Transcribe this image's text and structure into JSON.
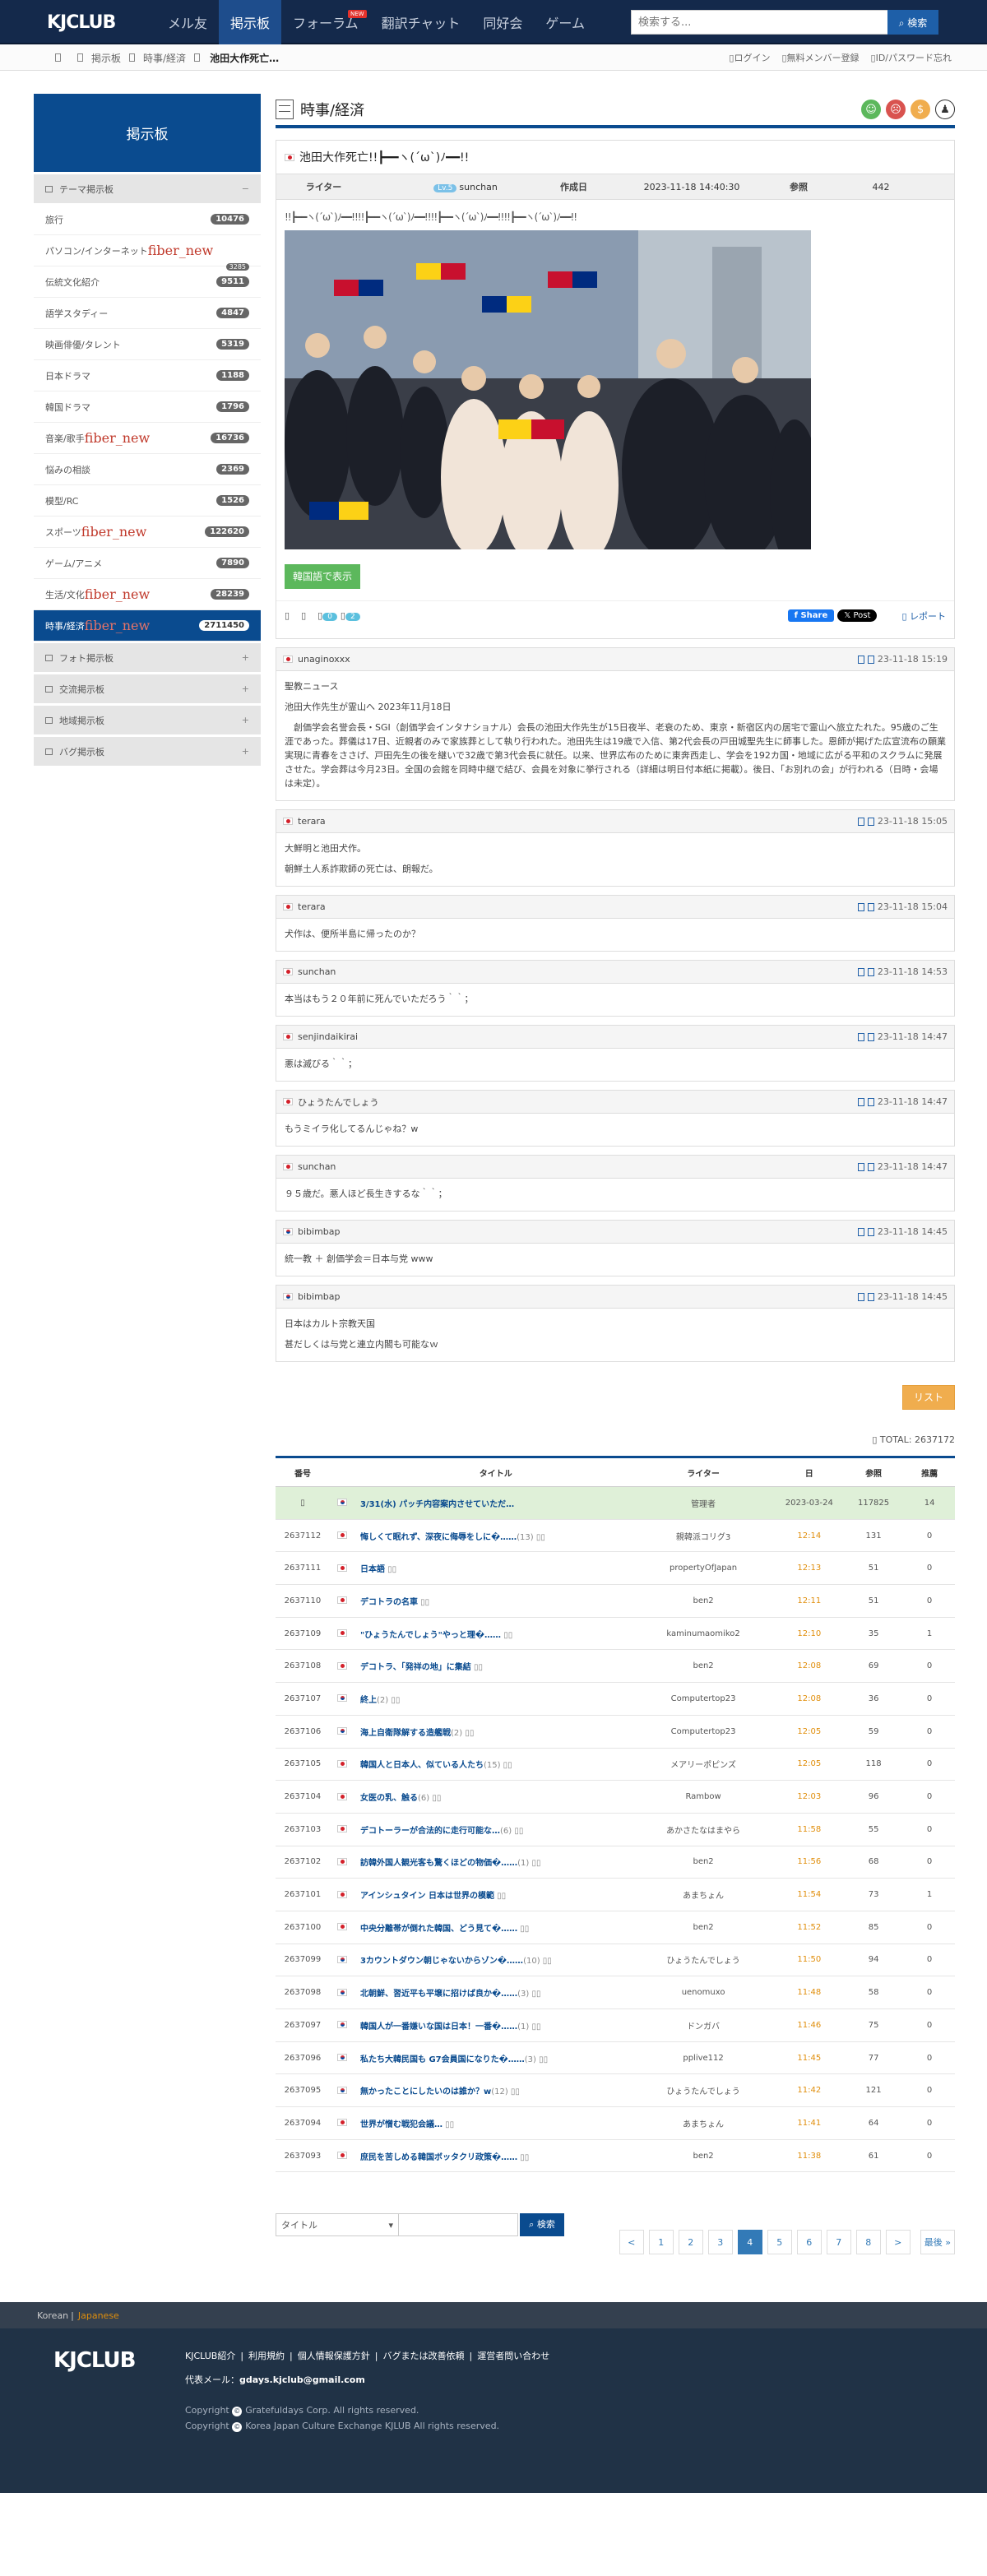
{
  "brand": {
    "logo": "KJCLUB"
  },
  "nav": {
    "items": [
      {
        "label": "メル友"
      },
      {
        "label": "掲示板",
        "active": true
      },
      {
        "label": "フォーラム",
        "badge": "NEW"
      },
      {
        "label": "翻訳チャット"
      },
      {
        "label": "同好会"
      },
      {
        "label": "ゲーム"
      }
    ],
    "search_placeholder": "検索する...",
    "search_button": "検索"
  },
  "breadcrumb": {
    "items": [
      "掲示板",
      "時事/経済",
      "池田大作死亡…"
    ]
  },
  "account": {
    "login": "ログイン",
    "register": "無料メンバー登録",
    "forgot": "ID/パスワード忘れ"
  },
  "sidebar": {
    "title": "掲示板",
    "section_theme": "テーマ掲示板",
    "section_theme_sym": "−",
    "items": [
      {
        "label": "旅行",
        "count": "10476"
      },
      {
        "label": "パソコン/インターネット",
        "suffix": "fiber_new",
        "count": "3285"
      },
      {
        "label": "伝統文化紹介",
        "count": "9511"
      },
      {
        "label": "語学スタディー",
        "count": "4847"
      },
      {
        "label": "映画俳優/タレント",
        "count": "5319"
      },
      {
        "label": "日本ドラマ",
        "count": "1188"
      },
      {
        "label": "韓国ドラマ",
        "count": "1796"
      },
      {
        "label": "音楽/歌手",
        "suffix": "fiber_new",
        "count": "16736"
      },
      {
        "label": "悩みの相談",
        "count": "2369"
      },
      {
        "label": "模型/RC",
        "count": "1526"
      },
      {
        "label": "スポーツ",
        "suffix": "fiber_new",
        "count": "122620"
      },
      {
        "label": "ゲーム/アニメ",
        "count": "7890"
      },
      {
        "label": "生活/文化",
        "suffix": "fiber_new",
        "count": "28239"
      },
      {
        "label": "時事/経済",
        "suffix": "fiber_new",
        "count": "2711450",
        "active": true
      }
    ],
    "sections": [
      {
        "label": "フォト掲示板",
        "sym": "+"
      },
      {
        "label": "交流掲示板",
        "sym": "+"
      },
      {
        "label": "地域掲示板",
        "sym": "+"
      },
      {
        "label": "バグ掲示板",
        "sym": "+"
      }
    ]
  },
  "page": {
    "title": "時事/経済"
  },
  "post": {
    "title": "池田大作死亡!!┣━━ヽ(´ω`)ﾉ━━!!",
    "meta": {
      "writer_label": "ライター",
      "writer_level": "Lv.5",
      "writer": "sunchan",
      "date_label": "作成日",
      "date": "2023-11-18 14:40:30",
      "views_label": "参照",
      "views": "442"
    },
    "body_line": "!!┣━━ヽ(´ω`)ﾉ━━!!!!┣━━ヽ(´ω`)ﾉ━━!!!!┣━━ヽ(´ω`)ﾉ━━!!!!┣━━ヽ(´ω`)ﾉ━━!!",
    "translate_button": "韓国語で表示",
    "like_count": "0",
    "dislike_count": "2",
    "share": {
      "facebook": "Share",
      "x": "Post"
    },
    "report": "レポート"
  },
  "comments": [
    {
      "author": "unaginoxxx",
      "flag": "jp",
      "time": "23-11-18 15:19",
      "lines": [
        "聖教ニュース",
        "池田大作先生が霊山へ 2023年11月18日",
        "　創価学会名誉会長・SGI（創価学会インタナショナル）会長の池田大作先生が15日夜半、老衰のため、東京・新宿区内の居宅で霊山へ旅立たれた。95歳のご生涯であった。葬儀は17日、近親者のみで家族葬として執り行われた。池田先生は19歳で入信、第2代会長の戸田城聖先生に師事した。恩師が掲げた広宣流布の願業実現に青春をささげ、戸田先生の後を継いで32歳で第3代会長に就任。以来、世界広布のために東奔西走し、学会を192カ国・地域に広がる平和のスクラムに発展させた。学会葬は今月23日。全国の会館を同時中継で結び、会員を対象に挙行される（詳細は明日付本紙に掲載）。後日、「お別れの会」が行われる（日時・会場は未定）。"
      ]
    },
    {
      "author": "terara",
      "flag": "jp",
      "time": "23-11-18 15:05",
      "lines": [
        "大鮮明と池田犬作。",
        "朝鮮土人系詐欺師の死亡は、朗報だ。"
      ]
    },
    {
      "author": "terara",
      "flag": "jp",
      "time": "23-11-18 15:04",
      "lines": [
        "犬作は、便所半島に帰ったのか？"
      ]
    },
    {
      "author": "sunchan",
      "flag": "jp",
      "time": "23-11-18 14:53",
      "lines": [
        "本当はもう２０年前に死んでいただろう｀｀；"
      ]
    },
    {
      "author": "senjindaikirai",
      "flag": "jp",
      "time": "23-11-18 14:47",
      "lines": [
        "悪は滅びる｀｀；"
      ]
    },
    {
      "author": "ひょうたんでしょう",
      "flag": "jp",
      "time": "23-11-18 14:47",
      "lines": [
        "もうミイラ化してるんじゃね？w"
      ]
    },
    {
      "author": "sunchan",
      "flag": "jp",
      "time": "23-11-18 14:47",
      "lines": [
        "９５歳だ。悪人ほど長生きするな｀｀；"
      ]
    },
    {
      "author": "bibimbap",
      "flag": "kr",
      "time": "23-11-18 14:45",
      "lines": [
        "統一教 ＋ 創価学会＝日本与党 www"
      ]
    },
    {
      "author": "bibimbap",
      "flag": "kr",
      "time": "23-11-18 14:45",
      "lines": [
        "日本はカルト宗教天国",
        "甚だしくは与党と連立内閣も可能なｗ"
      ]
    }
  ],
  "list_button": "リスト",
  "board": {
    "total": "TOTAL: 2637172",
    "headers": [
      "番号",
      "",
      "タイトル",
      "ライター",
      "日",
      "参照",
      "推薦"
    ],
    "notice": {
      "title": "3/31(水) パッチ内容案内させていただ…",
      "writer": "管理者",
      "date": "2023-03-24",
      "views": "117825",
      "rec": "14"
    },
    "rows": [
      {
        "no": "2637112",
        "flag": "jp",
        "title": "悔しくて眠れず、深夜に侮辱をしに�……",
        "cm": "(13)",
        "writer": "親韓派コリグ3",
        "time": "12:14",
        "views": "131",
        "rec": "0"
      },
      {
        "no": "2637111",
        "flag": "jp",
        "title": "日本語",
        "cm": "",
        "writer": "propertyOfJapan",
        "time": "12:13",
        "views": "51",
        "rec": "0"
      },
      {
        "no": "2637110",
        "flag": "jp",
        "title": "デコトラの名車",
        "cm": "",
        "writer": "ben2",
        "time": "12:11",
        "views": "51",
        "rec": "0"
      },
      {
        "no": "2637109",
        "flag": "jp",
        "title": "\"ひょうたんでしょう\"やっと理�……",
        "cm": "",
        "writer": "kaminumaomiko2",
        "time": "12:10",
        "views": "35",
        "rec": "1"
      },
      {
        "no": "2637108",
        "flag": "jp",
        "title": "デコトラ、「発祥の地」に集結",
        "cm": "",
        "writer": "ben2",
        "time": "12:08",
        "views": "69",
        "rec": "0"
      },
      {
        "no": "2637107",
        "flag": "kr",
        "title": "終上",
        "cm": "(2)",
        "writer": "Computertop23",
        "time": "12:08",
        "views": "36",
        "rec": "0"
      },
      {
        "no": "2637106",
        "flag": "kr",
        "title": "海上自衛隊解する造艦戦",
        "cm": "(2)",
        "writer": "Computertop23",
        "time": "12:05",
        "views": "59",
        "rec": "0"
      },
      {
        "no": "2637105",
        "flag": "jp",
        "title": "韓国人と日本人、似ている人たち",
        "cm": "(15)",
        "writer": "メアリーポピンズ",
        "time": "12:05",
        "views": "118",
        "rec": "0"
      },
      {
        "no": "2637104",
        "flag": "jp",
        "title": "女医の乳、触る",
        "cm": "(6)",
        "writer": "Rambow",
        "time": "12:03",
        "views": "96",
        "rec": "0"
      },
      {
        "no": "2637103",
        "flag": "jp",
        "title": "デコトーラーが合法的に走行可能な…",
        "cm": "(6)",
        "writer": "あかさたなはまやら",
        "time": "11:58",
        "views": "55",
        "rec": "0"
      },
      {
        "no": "2637102",
        "flag": "jp",
        "title": "訪韓外国人観光客も驚くほどの物価�……",
        "cm": "(1)",
        "writer": "ben2",
        "time": "11:56",
        "views": "68",
        "rec": "0"
      },
      {
        "no": "2637101",
        "flag": "jp",
        "title": "アインシュタイン 日本は世界の模範",
        "cm": "",
        "writer": "あまちょん",
        "time": "11:54",
        "views": "73",
        "rec": "1"
      },
      {
        "no": "2637100",
        "flag": "jp",
        "title": "中央分離帯が倒れた韓国、どう見て�……",
        "cm": "",
        "writer": "ben2",
        "time": "11:52",
        "views": "85",
        "rec": "0"
      },
      {
        "no": "2637099",
        "flag": "kr",
        "title": "3カウントダウン朝じゃないからゾン�……",
        "cm": "(10)",
        "writer": "ひょうたんでしょう",
        "time": "11:50",
        "views": "94",
        "rec": "0"
      },
      {
        "no": "2637098",
        "flag": "kr",
        "title": "北朝鮮、習近平も平壌に招けば良か�……",
        "cm": "(3)",
        "writer": "uenomuxo",
        "time": "11:48",
        "views": "58",
        "rec": "0"
      },
      {
        "no": "2637097",
        "flag": "kr",
        "title": "韓国人が一番嫌いな国は日本！一番�……",
        "cm": "(1)",
        "writer": "ドンガバ",
        "time": "11:46",
        "views": "75",
        "rec": "0"
      },
      {
        "no": "2637096",
        "flag": "kr",
        "title": "私たち大韓民国も G7会員国になりた�……",
        "cm": "(3)",
        "writer": "pplive112",
        "time": "11:45",
        "views": "77",
        "rec": "0"
      },
      {
        "no": "2637095",
        "flag": "kr",
        "title": "無かったことにしたいのは誰か？w",
        "cm": "(12)",
        "writer": "ひょうたんでしょう",
        "time": "11:42",
        "views": "121",
        "rec": "0"
      },
      {
        "no": "2637094",
        "flag": "jp",
        "title": "世界が憎む戦犯会議…",
        "cm": "",
        "writer": "あまちょん",
        "time": "11:41",
        "views": "64",
        "rec": "0"
      },
      {
        "no": "2637093",
        "flag": "jp",
        "title": "庶民を苦しめる韓国ボッタクリ政策�……",
        "cm": "",
        "writer": "ben2",
        "time": "11:38",
        "views": "61",
        "rec": "0"
      }
    ]
  },
  "board_search": {
    "select_value": "タイトル",
    "button": "検索"
  },
  "pagination": {
    "prev": "<",
    "pages": [
      "1",
      "2",
      "3",
      "4",
      "5",
      "6",
      "7",
      "8"
    ],
    "active": "4",
    "next": ">",
    "last": "最後 »"
  },
  "footer": {
    "lang_korean": "Korean",
    "lang_sep": "|",
    "lang_japanese": "Japanese",
    "logo": "KJCLUB",
    "links": [
      "KJCLUB紹介",
      "利用規約",
      "個人情報保護方針",
      "バグまたは改善依頼",
      "運営者問い合わせ"
    ],
    "mail_label": "代表メール：",
    "mail": "gdays.kjclub@gmail.com",
    "copy1": "Copyright",
    "copy1_text": "Gratefuldays Corp. All rights reserved.",
    "copy2": "Copyright",
    "copy2_text": "Korea Japan Culture Exchange KJLUB All rights reserved."
  },
  "colors": {
    "navy": "#14294b",
    "accent": "#0a4b8f",
    "orange": "#e08e0b",
    "green": "#5cb85c",
    "notice": "#dff0d8"
  }
}
